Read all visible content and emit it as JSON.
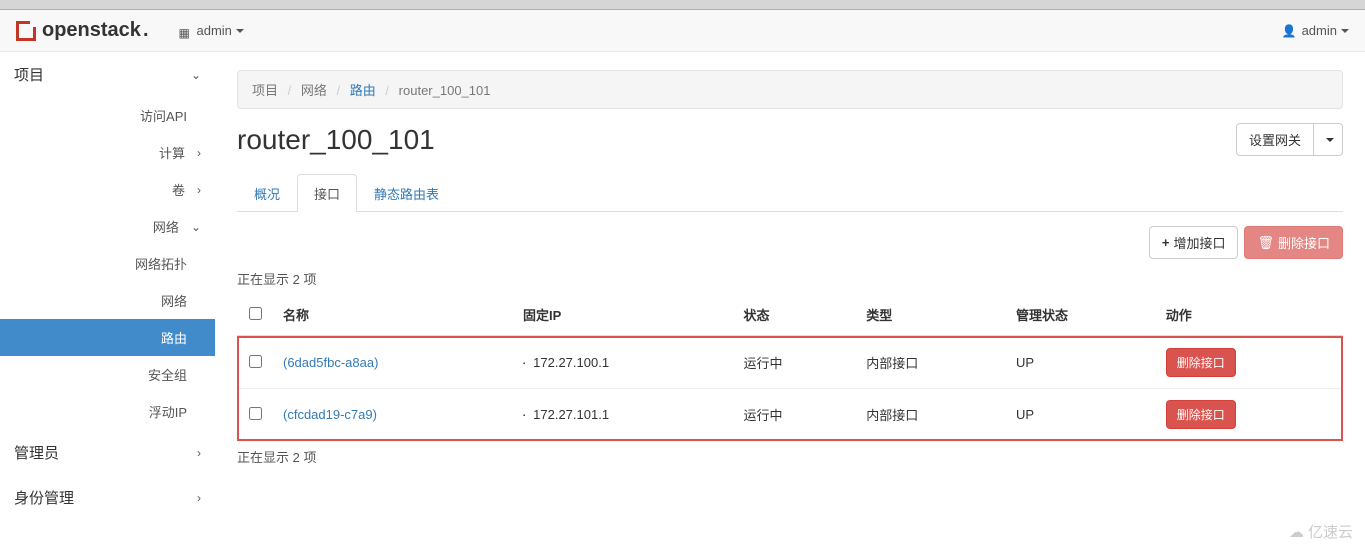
{
  "brand": {
    "name": "openstack"
  },
  "nav": {
    "project_selector": "admin",
    "user": "admin"
  },
  "sidebar": {
    "project": "项目",
    "access_api": "访问API",
    "compute": "计算",
    "volumes": "卷",
    "network": "网络",
    "topology": "网络拓扑",
    "networks": "网络",
    "routers": "路由",
    "securitygroups": "安全组",
    "floatingips": "浮动IP",
    "admin": "管理员",
    "identity": "身份管理"
  },
  "breadcrumb": {
    "project": "项目",
    "network": "网络",
    "routers": "路由",
    "current": "router_100_101"
  },
  "page": {
    "title": "router_100_101",
    "set_gateway": "设置网关"
  },
  "tabs": {
    "overview": "概况",
    "interfaces": "接口",
    "static_routes": "静态路由表"
  },
  "toolbar": {
    "add_interface": "增加接口",
    "delete_interfaces": "删除接口"
  },
  "table": {
    "count_top": "正在显示 2 项",
    "count_bottom": "正在显示 2 项",
    "cols": {
      "name": "名称",
      "fixed_ip": "固定IP",
      "status": "状态",
      "type": "类型",
      "admin_state": "管理状态",
      "actions": "动作"
    },
    "rows": [
      {
        "name": "(6dad5fbc-a8aa)",
        "ip": "172.27.100.1",
        "status": "运行中",
        "type": "内部接口",
        "admin_state": "UP",
        "action": "删除接口"
      },
      {
        "name": "(cfcdad19-c7a9)",
        "ip": "172.27.101.1",
        "status": "运行中",
        "type": "内部接口",
        "admin_state": "UP",
        "action": "删除接口"
      }
    ]
  },
  "watermark": "亿速云"
}
